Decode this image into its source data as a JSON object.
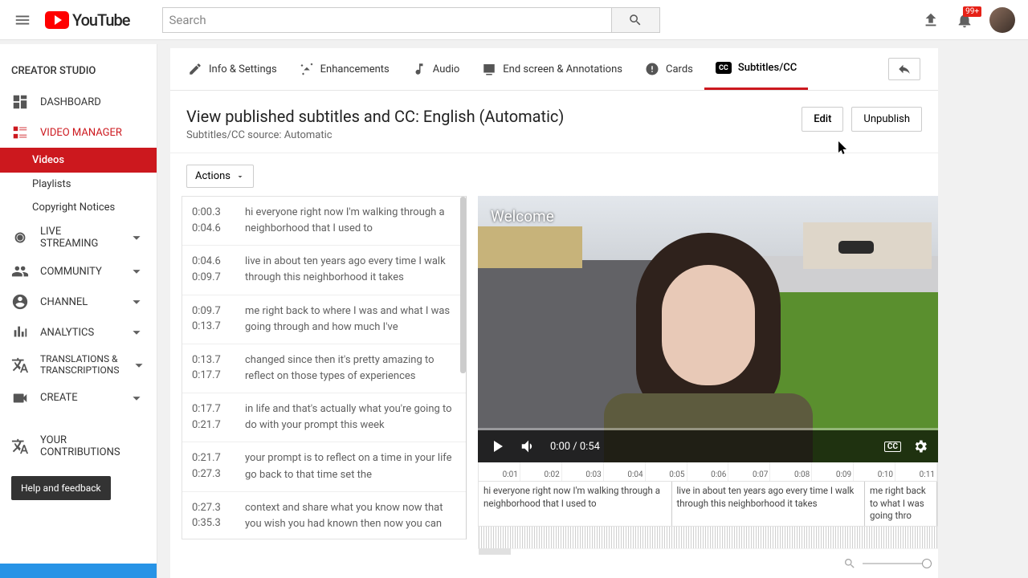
{
  "brand": "YouTube",
  "search": {
    "placeholder": "Search"
  },
  "notifications": {
    "count": "99+"
  },
  "sidebar": {
    "title": "CREATOR STUDIO",
    "items": [
      {
        "label": "DASHBOARD"
      },
      {
        "label": "VIDEO MANAGER"
      },
      {
        "label": "LIVE STREAMING"
      },
      {
        "label": "COMMUNITY"
      },
      {
        "label": "CHANNEL"
      },
      {
        "label": "ANALYTICS"
      },
      {
        "label": "TRANSLATIONS & TRANSCRIPTIONS"
      },
      {
        "label": "CREATE"
      },
      {
        "label": "YOUR CONTRIBUTIONS"
      }
    ],
    "videoManager": {
      "subs": [
        {
          "label": "Videos"
        },
        {
          "label": "Playlists"
        },
        {
          "label": "Copyright Notices"
        }
      ]
    },
    "help": "Help and feedback"
  },
  "tabs": [
    {
      "label": "Info & Settings"
    },
    {
      "label": "Enhancements"
    },
    {
      "label": "Audio"
    },
    {
      "label": "End screen & Annotations"
    },
    {
      "label": "Cards"
    },
    {
      "label": "Subtitles/CC"
    }
  ],
  "page": {
    "title": "View published subtitles and CC: English (Automatic)",
    "subtitle": "Subtitles/CC source: Automatic",
    "edit": "Edit",
    "unpublish": "Unpublish",
    "actions": "Actions"
  },
  "captions": [
    {
      "t1": "0:00.3",
      "t2": "0:04.6",
      "text": "hi everyone right now I'm walking through a neighborhood that I used to"
    },
    {
      "t1": "0:04.6",
      "t2": "0:09.7",
      "text": "live in about ten years ago every time I walk through this neighborhood it takes"
    },
    {
      "t1": "0:09.7",
      "t2": "0:13.7",
      "text": "me right back to where I was and what I was going through and how much I've"
    },
    {
      "t1": "0:13.7",
      "t2": "0:17.7",
      "text": "changed since then it's pretty amazing to reflect on those types of experiences"
    },
    {
      "t1": "0:17.7",
      "t2": "0:21.7",
      "text": "in life and that's actually what you're going to do with your prompt this week"
    },
    {
      "t1": "0:21.7",
      "t2": "0:27.3",
      "text": "your prompt is to reflect on a time in your life go back to that time set the"
    },
    {
      "t1": "0:27.3",
      "t2": "0:35.3",
      "text": "context and share what you know now that\nyou wish you had known then now you can"
    }
  ],
  "video": {
    "overlay": "Welcome",
    "time": "0:00 / 0:54"
  },
  "ruler": [
    "0:01",
    "0:02",
    "0:03",
    "0:04",
    "0:05",
    "0:06",
    "0:07",
    "0:08",
    "0:09",
    "0:10",
    "0:11"
  ],
  "segments": [
    "hi everyone right now I'm walking through a neighborhood that I used to",
    "live in about ten years ago every time I walk through this neighborhood it takes",
    "me right back to what I\nwas going thro"
  ]
}
